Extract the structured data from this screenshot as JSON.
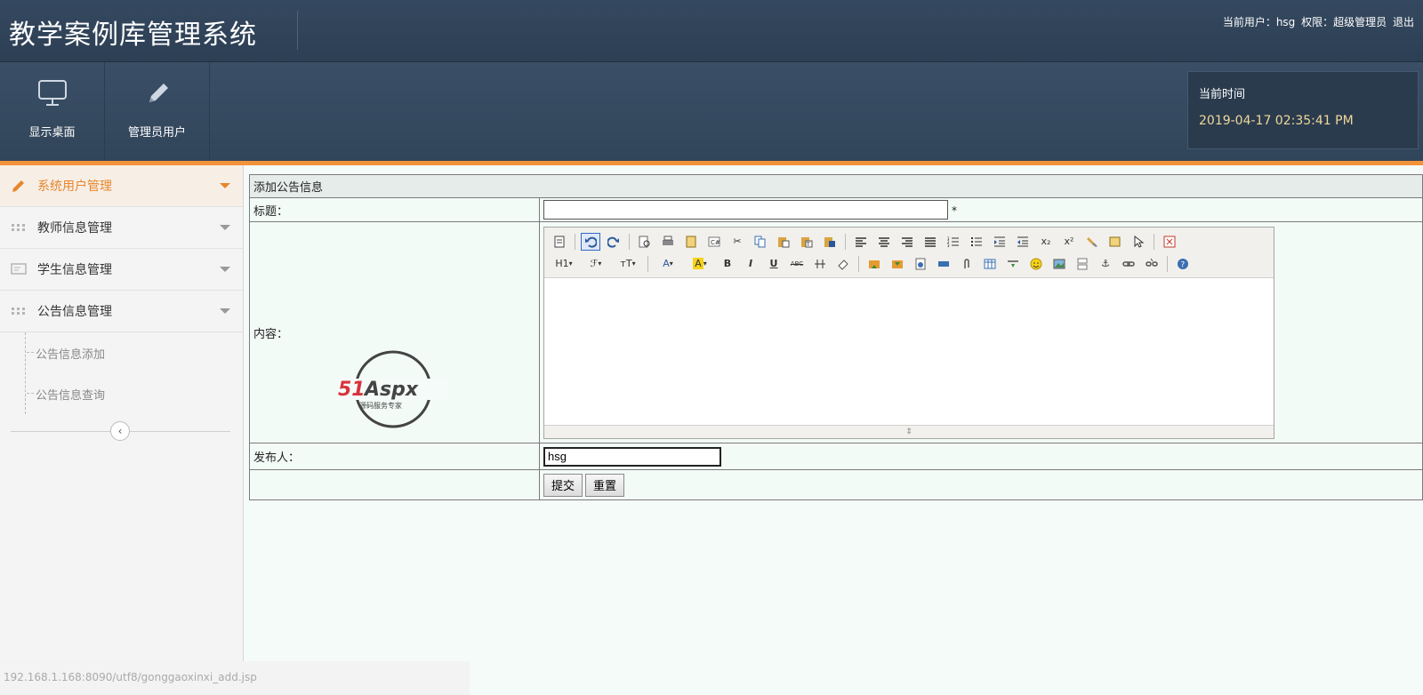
{
  "app": {
    "title": "教学案例库管理系统"
  },
  "user_bar": {
    "current_user": "当前用户：hsg",
    "permission": "权限：超级管理员",
    "logout": "退出"
  },
  "nav": {
    "items": [
      {
        "label": "显示桌面",
        "icon": "monitor-icon"
      },
      {
        "label": "管理员用户",
        "icon": "pencil-icon"
      }
    ]
  },
  "time_box": {
    "label": "当前时间",
    "value": "2019-04-17 02:35:41 PM"
  },
  "sidebar": {
    "menus": [
      {
        "label": "系统用户管理",
        "icon": "pencil-icon",
        "active": true
      },
      {
        "label": "教师信息管理",
        "icon": "grid-icon"
      },
      {
        "label": "学生信息管理",
        "icon": "screen-icon"
      },
      {
        "label": "公告信息管理",
        "icon": "grid-icon"
      }
    ],
    "sub_items": [
      {
        "label": "公告信息添加"
      },
      {
        "label": "公告信息查询"
      }
    ]
  },
  "form": {
    "heading": "添加公告信息",
    "title_label": "标题：",
    "title_value": "",
    "required_mark": "*",
    "content_label": "内容：",
    "publisher_label": "发布人：",
    "publisher_value": "hsg",
    "submit_label": "提交",
    "reset_label": "重置"
  },
  "editor": {
    "heading_select": "H1",
    "font_size_btn": "ᴛT",
    "bold": "B",
    "italic": "I",
    "underline": "U",
    "strike": "ABC"
  },
  "watermark": {
    "brand": "51Aspx",
    "tagline": "源码服务专家"
  },
  "status_bar": {
    "url": "192.168.1.168:8090/utf8/gonggaoxinxi_add.jsp"
  },
  "colors": {
    "header_bg": "#34485f",
    "accent_orange": "#f2923a",
    "time_text": "#f1d89a",
    "form_bg": "#f3fbf7"
  }
}
